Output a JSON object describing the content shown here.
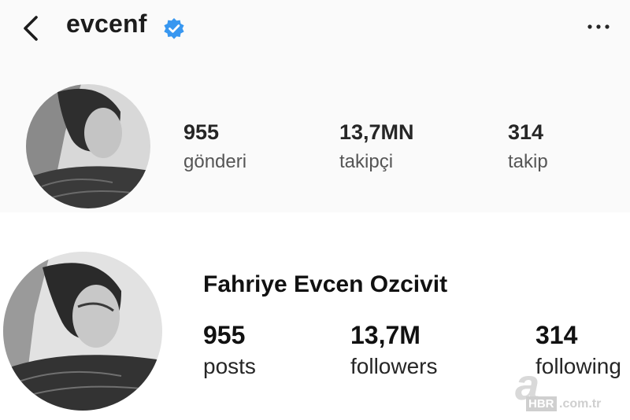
{
  "header": {
    "back_icon": "chevron-left-icon",
    "username": "evcenf",
    "verified_icon": "verified-badge-icon",
    "verified_color": "#3897f0",
    "more_icon": "more-horizontal-icon"
  },
  "profile_tr": {
    "stats": [
      {
        "value": "955",
        "label": "gönderi"
      },
      {
        "value": "13,7MN",
        "label": "takipçi"
      },
      {
        "value": "314",
        "label": "takip"
      }
    ]
  },
  "profile_en": {
    "full_name": "Fahriye Evcen Ozcivit",
    "stats": [
      {
        "value": "955",
        "label": "posts"
      },
      {
        "value": "13,7M",
        "label": "followers"
      },
      {
        "value": "314",
        "label": "following"
      }
    ]
  },
  "watermark": {
    "mark": "a",
    "brand": "HBR",
    "domain": ".com.tr"
  }
}
